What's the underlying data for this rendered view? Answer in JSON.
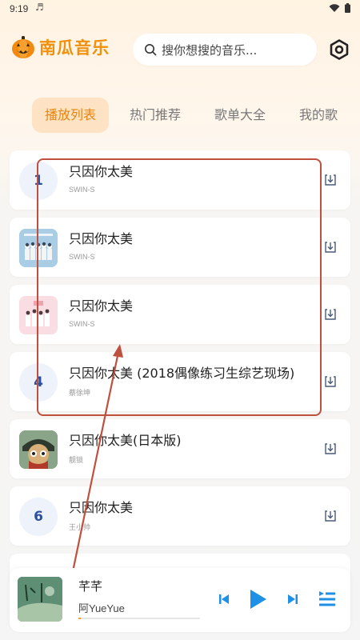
{
  "status": {
    "time": "9:19",
    "note_icon": "music-note-icon"
  },
  "app": {
    "name": "南瓜音乐",
    "brand_color": "#f0900f"
  },
  "search": {
    "placeholder": "搜你想搜的音乐..."
  },
  "tabs": [
    {
      "label": "播放列表",
      "active": true
    },
    {
      "label": "热门推荐",
      "active": false
    },
    {
      "label": "歌单大全",
      "active": false
    },
    {
      "label": "我的歌",
      "active": false
    }
  ],
  "songs": [
    {
      "rank": "1",
      "title": "只因你太美",
      "artist": "SWIN-S",
      "cover": "rank-number"
    },
    {
      "rank": "",
      "title": "只因你太美",
      "artist": "SWIN-S",
      "cover": "group-photo-blue"
    },
    {
      "rank": "",
      "title": "只因你太美",
      "artist": "SWIN-S",
      "cover": "group-photo-pink"
    },
    {
      "rank": "4",
      "title": "只因你太美 (2018偶像练习生综艺现场)",
      "artist": "蔡徐坤",
      "cover": "rank-number"
    },
    {
      "rank": "",
      "title": "只因你太美(日本版)",
      "artist": "靓锁",
      "cover": "cartoon-avatar"
    },
    {
      "rank": "6",
      "title": "只因你太美",
      "artist": "王小帅",
      "cover": "rank-number"
    }
  ],
  "player": {
    "title": "芊芊",
    "artist": "阿YueYue",
    "progress": 0.02,
    "accent": "#1e90e6"
  },
  "colors": {
    "annotation": "#c0503e",
    "tab_active_bg": "#fde3c3",
    "tab_active_text": "#e8840f"
  }
}
